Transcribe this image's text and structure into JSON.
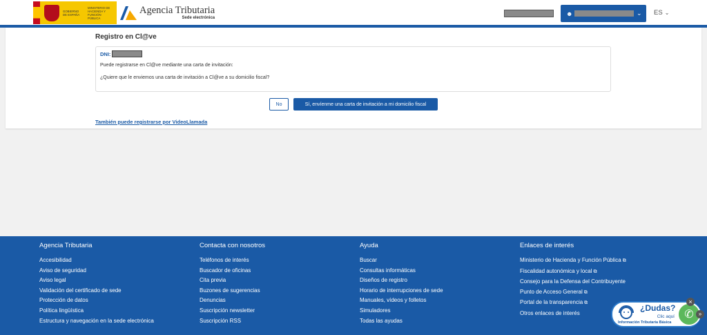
{
  "header": {
    "gob_text_1": "GOBIERNO DE ESPAÑA",
    "gob_text_2": "MINISTERIO DE HACIENDA Y FUNCIÓN PÚBLICA",
    "agency_name": "Agencia Tributaria",
    "agency_sub": "Sede electrónica",
    "lang": "ES"
  },
  "main": {
    "title": "Registro en Cl@ve",
    "dni_label": "DNI:",
    "line1": "Puede registrarse en Cl@ve mediante una carta de invitación:",
    "line2": "¿Quiere que le enviemos una carta de invitación a Cl@ve a su domicilio fiscal?",
    "btn_no": "No",
    "btn_yes": "Sí, envíenme una carta de invitación a mi domicilio fiscal",
    "video_link": "También puede registrarse por VideoLlamada"
  },
  "footer": {
    "col1": {
      "title": "Agencia Tributaria",
      "items": [
        "Accesibilidad",
        "Aviso de seguridad",
        "Aviso legal",
        "Validación del certificado de sede",
        "Protección de datos",
        "Política lingüística",
        "Estructura y navegación en la sede electrónica"
      ]
    },
    "col2": {
      "title": "Contacta con nosotros",
      "items": [
        "Teléfonos de interés",
        "Buscador de oficinas",
        "Cita previa",
        "Buzones de sugerencias",
        "Denuncias",
        "Suscripción newsletter",
        "Suscripción RSS"
      ]
    },
    "col3": {
      "title": "Ayuda",
      "items": [
        "Buscar",
        "Consultas informáticas",
        "Diseños de registro",
        "Horario de interrupciones de sede",
        "Manuales, vídeos y folletos",
        "Simuladores",
        "Todas las ayudas"
      ]
    },
    "col4": {
      "title": "Enlaces de interés",
      "items": [
        "Ministerio de Hacienda y Función Pública",
        "Fiscalidad autonómica y local",
        "Consejo para la Defensa del Contribuyente",
        "Punto de Acceso General",
        "Portal de la transparencia",
        "Otros enlaces de interés"
      ]
    }
  },
  "dudas": {
    "title": "¿Dudas?",
    "clic": "Clic aquí",
    "sub": "Información Tributaria Básica"
  },
  "colors": {
    "brand_blue": "#1a5aa6",
    "footer_bg": "#1a5aa6"
  }
}
